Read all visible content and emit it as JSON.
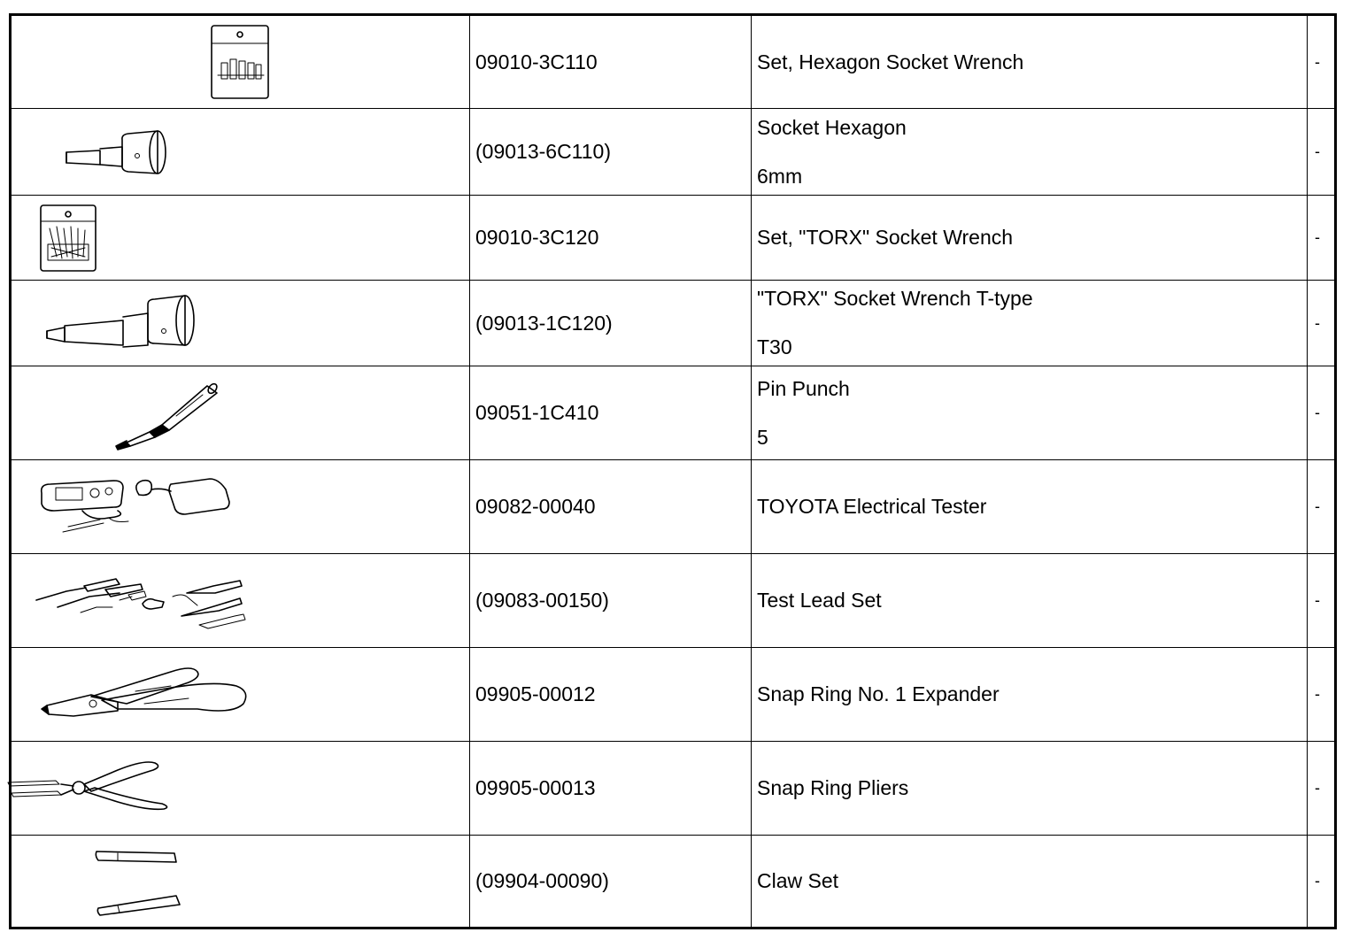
{
  "tools": [
    {
      "icon": "hexagon-socket-wrench-set-icon",
      "part_no": "09010-3C110",
      "name": "Set, Hexagon Socket Wrench",
      "sub": "",
      "note": "-"
    },
    {
      "icon": "hexagon-socket-icon",
      "part_no": "(09013-6C110)",
      "name": "Socket Hexagon",
      "sub": "6mm",
      "note": "-"
    },
    {
      "icon": "torx-socket-wrench-set-icon",
      "part_no": "09010-3C120",
      "name": "Set, \"TORX\" Socket Wrench",
      "sub": "",
      "note": "-"
    },
    {
      "icon": "torx-socket-icon",
      "part_no": "(09013-1C120)",
      "name": "\"TORX\" Socket Wrench T-type",
      "sub": "T30",
      "note": "-"
    },
    {
      "icon": "pin-punch-icon",
      "part_no": "09051-1C410",
      "name": "Pin Punch",
      "sub": "5",
      "note": "-"
    },
    {
      "icon": "electrical-tester-icon",
      "part_no": "09082-00040",
      "name": "TOYOTA Electrical Tester",
      "sub": "",
      "note": "-"
    },
    {
      "icon": "test-lead-set-icon",
      "part_no": "(09083-00150)",
      "name": "Test Lead Set",
      "sub": "",
      "note": "-"
    },
    {
      "icon": "snap-ring-expander-icon",
      "part_no": "09905-00012",
      "name": "Snap Ring No. 1 Expander",
      "sub": "",
      "note": "-"
    },
    {
      "icon": "snap-ring-pliers-icon",
      "part_no": "09905-00013",
      "name": "Snap Ring Pliers",
      "sub": "",
      "note": "-"
    },
    {
      "icon": "claw-set-icon",
      "part_no": "(09904-00090)",
      "name": "Claw Set",
      "sub": "",
      "note": "-"
    }
  ]
}
